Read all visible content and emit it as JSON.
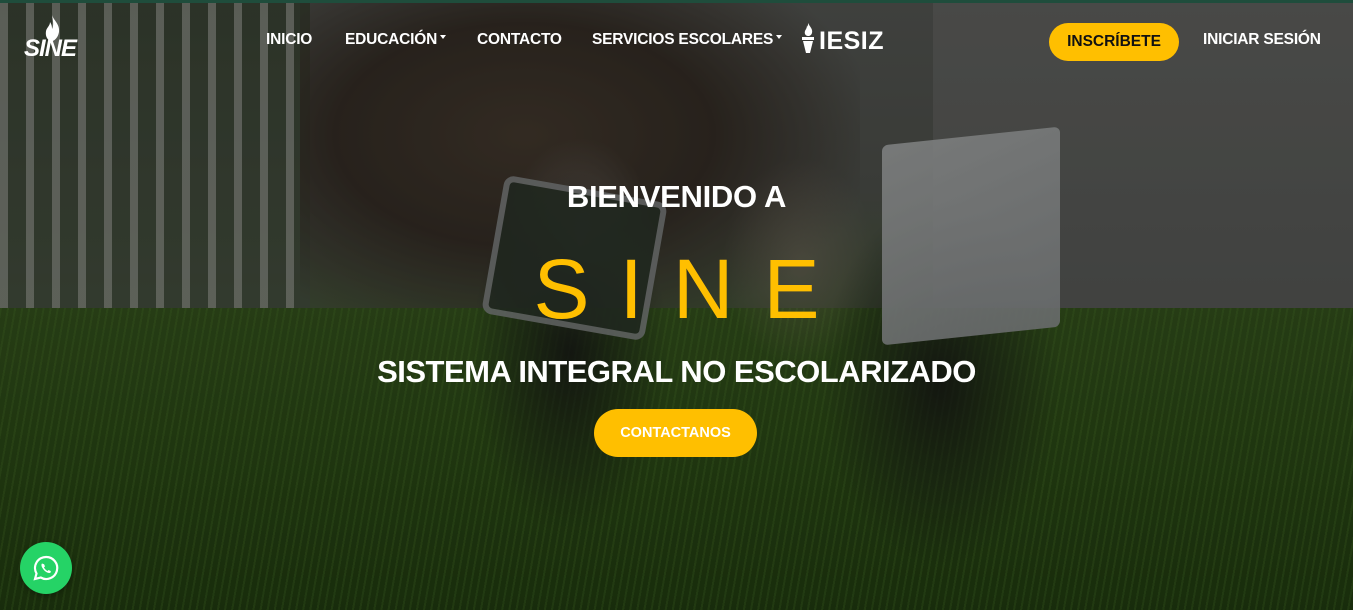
{
  "brand": {
    "logo_text": "SINE",
    "partner_logo_text": "IESIZ"
  },
  "nav": {
    "items": [
      {
        "label": "INICIO",
        "has_dropdown": false
      },
      {
        "label": "EDUCACIÓN",
        "has_dropdown": true
      },
      {
        "label": "CONTACTO",
        "has_dropdown": false
      },
      {
        "label": "SERVICIOS ESCOLARES",
        "has_dropdown": true
      }
    ],
    "cta_label": "INSCRÍBETE",
    "login_label": "INICIAR SESIÓN"
  },
  "hero": {
    "welcome": "BIENVENIDO A",
    "brand_big": "SINE",
    "subtitle": "SISTEMA INTEGRAL NO ESCOLARIZADO",
    "cta_label": "CONTACTANOS"
  },
  "floating": {
    "icon": "whatsapp-icon"
  },
  "colors": {
    "accent": "#ffbf00",
    "whatsapp": "#25d366",
    "text": "#ffffff"
  }
}
